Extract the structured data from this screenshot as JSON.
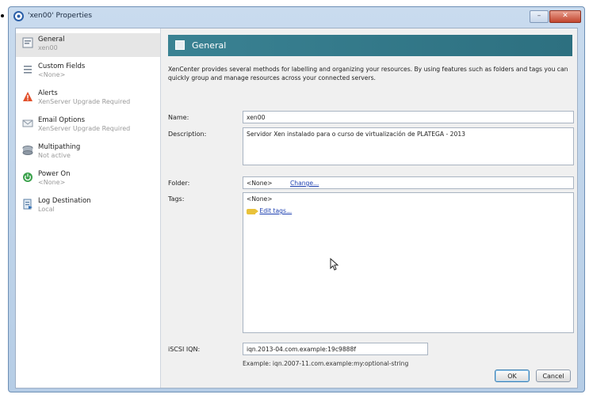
{
  "window": {
    "title": "'xen00' Properties",
    "minimize": "–",
    "close": "✕"
  },
  "sidebar": {
    "items": [
      {
        "label": "General",
        "sub": "xen00",
        "icon": "general-page-icon"
      },
      {
        "label": "Custom Fields",
        "sub": "<None>",
        "icon": "custom-fields-icon"
      },
      {
        "label": "Alerts",
        "sub": "XenServer Upgrade Required",
        "icon": "alert-warning-icon"
      },
      {
        "label": "Email Options",
        "sub": "XenServer Upgrade Required",
        "icon": "email-icon"
      },
      {
        "label": "Multipathing",
        "sub": "Not active",
        "icon": "multipathing-icon"
      },
      {
        "label": "Power On",
        "sub": "<None>",
        "icon": "power-on-icon"
      },
      {
        "label": "Log Destination",
        "sub": "Local",
        "icon": "log-destination-icon"
      }
    ]
  },
  "header": {
    "title": "General"
  },
  "intro": "XenCenter provides several methods for labelling and organizing your resources. By using features such as folders and tags you can quickly group and manage resources across your connected servers.",
  "form": {
    "name_label": "Name:",
    "name_value": "xen00",
    "description_label": "Description:",
    "description_value": "Servidor Xen instalado para o curso de virtualización de PLATEGA - 2013",
    "folder_label": "Folder:",
    "folder_value": "<None>",
    "folder_change": "Change...",
    "tags_label": "Tags:",
    "tags_value": "<None>",
    "tags_edit": "Edit tags...",
    "iqn_label": "iSCSI IQN:",
    "iqn_value": "iqn.2013-04.com.example:19c9888f",
    "iqn_example": "Example: iqn.2007-11.com.example:my:optional-string"
  },
  "buttons": {
    "ok": "OK",
    "cancel": "Cancel"
  },
  "colors": {
    "header_bg": "#3a8293",
    "selected_item_bg": "#e6e6e6",
    "link": "#1c3fb0"
  }
}
